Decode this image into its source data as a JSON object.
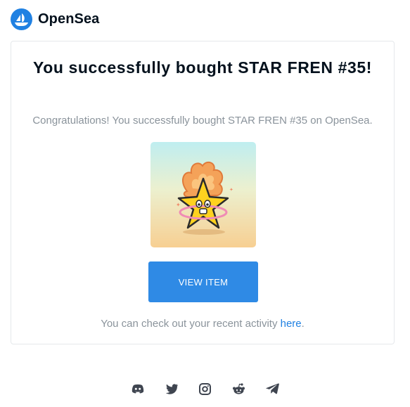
{
  "brand": {
    "name": "OpenSea",
    "logo_icon": "opensea-boat-icon",
    "color": "#2081E2"
  },
  "card": {
    "title": "You successfully bought STAR FREN #35!",
    "subtitle": "Congratulations! You successfully bought STAR FREN #35 on OpenSea.",
    "nft_image_icon": "star-fren-character-image",
    "button_label": "VIEW ITEM",
    "button_color": "#2f8ae5",
    "activity_prefix": "You can check out your recent activity ",
    "activity_link": "here",
    "activity_suffix": "."
  },
  "footer": {
    "social_icons": [
      "discord-icon",
      "twitter-icon",
      "instagram-icon",
      "reddit-icon",
      "telegram-icon"
    ],
    "icon_color": "#3f4550"
  }
}
